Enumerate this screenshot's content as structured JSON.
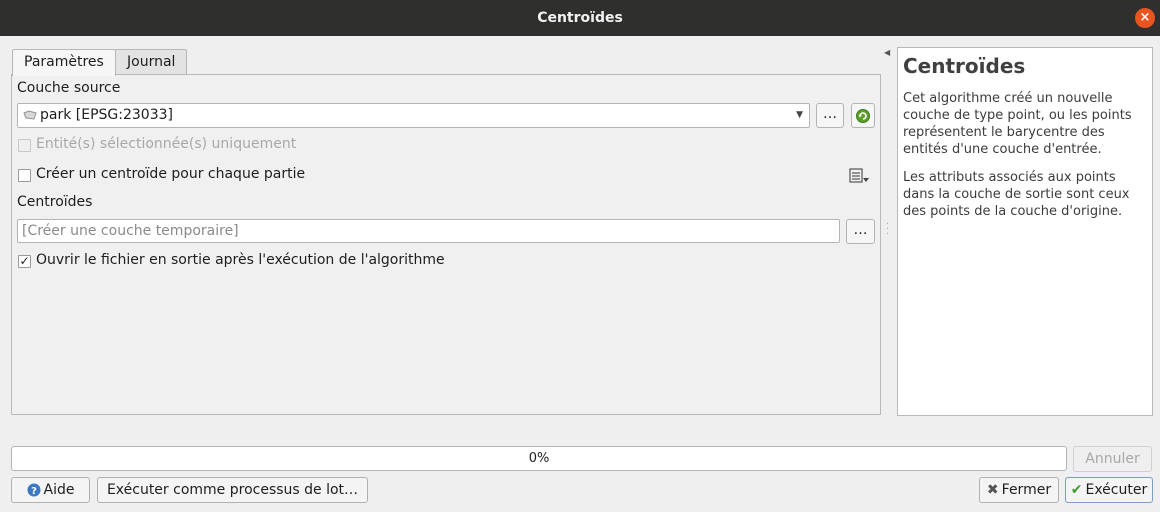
{
  "window": {
    "title": "Centroïdes"
  },
  "tabs": [
    {
      "label": "Paramètres"
    },
    {
      "label": "Journal"
    }
  ],
  "form": {
    "source_label": "Couche source",
    "source_value": "park [EPSG:23033]",
    "browse_label": "…",
    "selected_only_label": "Entité(s) sélectionnée(s) uniquement",
    "each_part_label": "Créer un centroïde pour chaque partie",
    "output_label": "Centroïdes",
    "output_placeholder": "[Créer une couche temporaire]",
    "output_browse_label": "…",
    "open_output_label": "Ouvrir le fichier en sortie après l'exécution de l'algorithme",
    "open_output_checked": "✓"
  },
  "help": {
    "title": "Centroïdes",
    "paragraphs": [
      "Cet algorithme créé un nouvelle couche de type point, ou les points représentent le barycentre des entités d'une couche d'entrée.",
      "Les attributs associés aux points dans la couche de sortie sont ceux des points de la couche d'origine."
    ]
  },
  "progress": {
    "text": "0%",
    "value": 0
  },
  "buttons": {
    "cancel": "Annuler",
    "help": "Aide",
    "batch": "Exécuter comme processus de lot…",
    "close": "Fermer",
    "run": "Exécuter"
  },
  "colors": {
    "close_button": "#e95420",
    "titlebar": "#2f2f2d"
  }
}
